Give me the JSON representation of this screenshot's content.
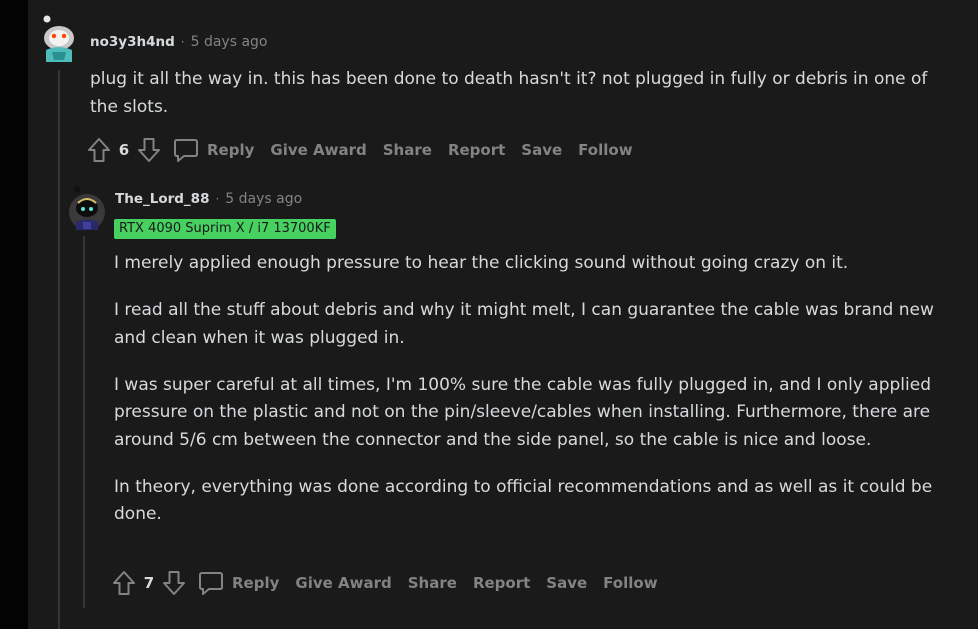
{
  "comments": [
    {
      "author": "no3y3h4nd",
      "separator": "·",
      "time": "5 days ago",
      "paragraphs": [
        "plug it all the way in. this has been done to death hasn't it? not plugged in fully or debris in one of the slots."
      ],
      "score": "6",
      "avatar_icon": "snoo-avatar-icon"
    },
    {
      "author": "The_Lord_88",
      "separator": "·",
      "time": "5 days ago",
      "flair": "RTX 4090 Suprim X / i7 13700KF",
      "paragraphs": [
        "I merely applied enough pressure to hear the clicking sound without going crazy on it.",
        "I read all the stuff about debris and why it might melt, I can guarantee the cable was brand new and clean when it was plugged in.",
        "I was super careful at all times, I'm 100% sure the cable was fully plugged in, and I only applied pressure on the plastic and not on the pin/sleeve/cables when installing. Furthermore, there are around 5/6 cm between the connector and the side panel, so the cable is nice and loose.",
        "In theory, everything was done according to official recommendations and as well as it could be done."
      ],
      "score": "7",
      "avatar_icon": "snoo-avatar-icon"
    }
  ],
  "actions": {
    "reply": "Reply",
    "give_award": "Give Award",
    "share": "Share",
    "report": "Report",
    "save": "Save",
    "follow": "Follow"
  },
  "colors": {
    "page_bg": "#1a1a1b",
    "outer_bg": "#030303",
    "text": "#d7dadc",
    "muted": "#818384",
    "flair_bg": "#46d160",
    "thread_line": "#343536"
  }
}
